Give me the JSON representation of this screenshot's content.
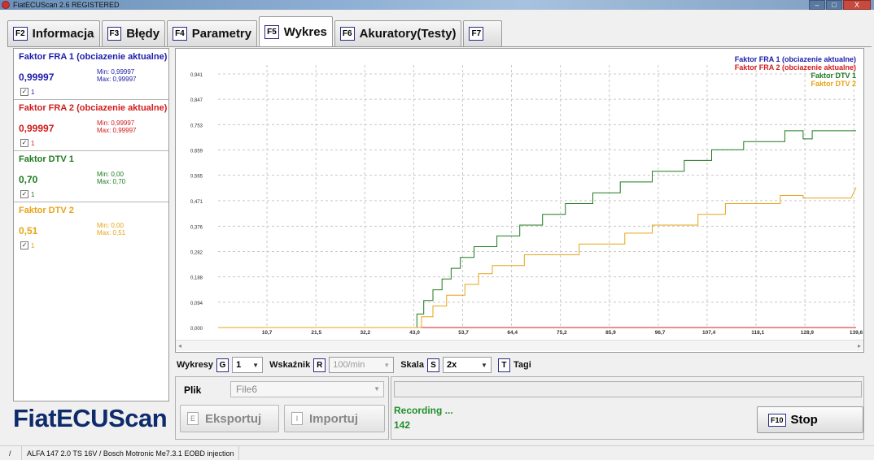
{
  "window": {
    "title": "FiatECUScan 2.6 REGISTERED",
    "minimize": "–",
    "maximize": "□",
    "close": "X"
  },
  "tabs": [
    {
      "key": "F2",
      "label": "Informacja"
    },
    {
      "key": "F3",
      "label": "Błędy"
    },
    {
      "key": "F4",
      "label": "Parametry"
    },
    {
      "key": "F5",
      "label": "Wykres",
      "active": true
    },
    {
      "key": "F6",
      "label": "Akuratory(Testy)"
    },
    {
      "key": "F7",
      "label": ""
    }
  ],
  "params": [
    {
      "title": "Faktor FRA 1 (obciazenie aktualne)",
      "value": "0,99997",
      "min": "Min: 0,99997",
      "max": "Max: 0,99997",
      "check": "1",
      "color": "#1d1daa"
    },
    {
      "title": "Faktor FRA 2 (obciazenie aktualne)",
      "value": "0,99997",
      "min": "Min: 0,99997",
      "max": "Max: 0,99997",
      "check": "1",
      "color": "#d01c1c"
    },
    {
      "title": "Faktor DTV 1",
      "value": "0,70",
      "min": "Min: 0,00",
      "max": "Max: 0,70",
      "check": "1",
      "color": "#1f7a1f"
    },
    {
      "title": "Faktor DTV 2",
      "value": "0,51",
      "min": "Min: 0,00",
      "max": "Max: 0,51",
      "check": "1",
      "color": "#e8a317"
    }
  ],
  "brand": "FiatECUScan",
  "chart_data": {
    "type": "line",
    "y_ticks": [
      "0,000",
      "0,094",
      "0,188",
      "0,282",
      "0,376",
      "0,471",
      "0,565",
      "0,659",
      "0,753",
      "0,847",
      "0,941"
    ],
    "y_tick_values": [
      0,
      0.094,
      0.188,
      0.282,
      0.376,
      0.471,
      0.565,
      0.659,
      0.753,
      0.847,
      0.941
    ],
    "x_ticks": [
      "10,7",
      "21,5",
      "32,2",
      "43,0",
      "53,7",
      "64,4",
      "75,2",
      "85,9",
      "96,7",
      "107,4",
      "118,1",
      "128,9",
      "139,6"
    ],
    "x_tick_values": [
      10.7,
      21.5,
      32.2,
      43.0,
      53.7,
      64.4,
      75.2,
      85.9,
      96.7,
      107.4,
      118.1,
      128.9,
      139.6
    ],
    "xlim": [
      0,
      139.6
    ],
    "ylim": [
      0,
      0.95
    ],
    "grid": true,
    "legend_position": "top-right",
    "series": [
      {
        "name": "Faktor FRA 1 (obciazenie aktualne)",
        "color": "#1d1daa",
        "points": []
      },
      {
        "name": "Faktor FRA 2 (obciazenie aktualne)",
        "color": "#d01c1c",
        "points": [
          [
            0,
            0
          ],
          [
            139.6,
            0
          ]
        ]
      },
      {
        "name": "Faktor DTV 1",
        "color": "#1f7a1f",
        "points": [
          [
            0,
            0
          ],
          [
            43.5,
            0
          ],
          [
            43.5,
            0.05
          ],
          [
            45,
            0.05
          ],
          [
            45,
            0.1
          ],
          [
            47,
            0.1
          ],
          [
            47,
            0.14
          ],
          [
            49,
            0.14
          ],
          [
            49,
            0.18
          ],
          [
            51,
            0.18
          ],
          [
            51,
            0.22
          ],
          [
            53,
            0.22
          ],
          [
            53,
            0.26
          ],
          [
            56,
            0.26
          ],
          [
            56,
            0.3
          ],
          [
            61,
            0.3
          ],
          [
            61,
            0.34
          ],
          [
            66,
            0.34
          ],
          [
            66,
            0.38
          ],
          [
            71,
            0.38
          ],
          [
            71,
            0.42
          ],
          [
            76,
            0.42
          ],
          [
            76,
            0.46
          ],
          [
            82,
            0.46
          ],
          [
            82,
            0.5
          ],
          [
            88,
            0.5
          ],
          [
            88,
            0.54
          ],
          [
            95,
            0.54
          ],
          [
            95,
            0.58
          ],
          [
            102,
            0.58
          ],
          [
            102,
            0.62
          ],
          [
            108,
            0.62
          ],
          [
            108,
            0.66
          ],
          [
            115,
            0.66
          ],
          [
            115,
            0.69
          ],
          [
            124,
            0.69
          ],
          [
            124,
            0.73
          ],
          [
            128,
            0.73
          ],
          [
            128,
            0.7
          ],
          [
            130,
            0.7
          ],
          [
            130,
            0.73
          ],
          [
            139.6,
            0.73
          ]
        ]
      },
      {
        "name": "Faktor DTV 2",
        "color": "#e8a317",
        "points": [
          [
            0,
            0
          ],
          [
            44.5,
            0
          ],
          [
            44.5,
            0.04
          ],
          [
            47,
            0.04
          ],
          [
            47,
            0.08
          ],
          [
            50,
            0.08
          ],
          [
            50,
            0.12
          ],
          [
            54,
            0.12
          ],
          [
            54,
            0.16
          ],
          [
            57,
            0.16
          ],
          [
            57,
            0.2
          ],
          [
            60,
            0.2
          ],
          [
            60,
            0.23
          ],
          [
            67,
            0.23
          ],
          [
            67,
            0.27
          ],
          [
            79,
            0.27
          ],
          [
            79,
            0.31
          ],
          [
            89,
            0.31
          ],
          [
            89,
            0.35
          ],
          [
            95,
            0.35
          ],
          [
            95,
            0.38
          ],
          [
            105,
            0.38
          ],
          [
            105,
            0.42
          ],
          [
            111,
            0.42
          ],
          [
            111,
            0.46
          ],
          [
            123,
            0.46
          ],
          [
            123,
            0.49
          ],
          [
            128,
            0.49
          ],
          [
            128,
            0.48
          ],
          [
            138.5,
            0.48
          ],
          [
            139.6,
            0.52
          ]
        ]
      }
    ]
  },
  "controls": {
    "wykresy_label": "Wykresy",
    "wykresy_key": "G",
    "wykresy_value": "1",
    "wskaznik_label": "Wskaźnik",
    "wskaznik_key": "R",
    "wskaznik_value": "100/min",
    "skala_label": "Skala",
    "skala_key": "S",
    "skala_value": "2x",
    "tagi_key": "T",
    "tagi_label": "Tagi"
  },
  "file": {
    "label": "Plik",
    "value": "File6",
    "export_key": "E",
    "export_label": "Eksportuj",
    "import_key": "I",
    "import_label": "Importuj"
  },
  "status": {
    "recording": "Recording ...",
    "count": "142",
    "stop_key": "F10",
    "stop_label": "Stop"
  },
  "statusbar": {
    "sep": "/",
    "car": "ALFA 147 2.0 TS 16V / Bosch Motronic Me7.3.1 EOBD injection"
  }
}
